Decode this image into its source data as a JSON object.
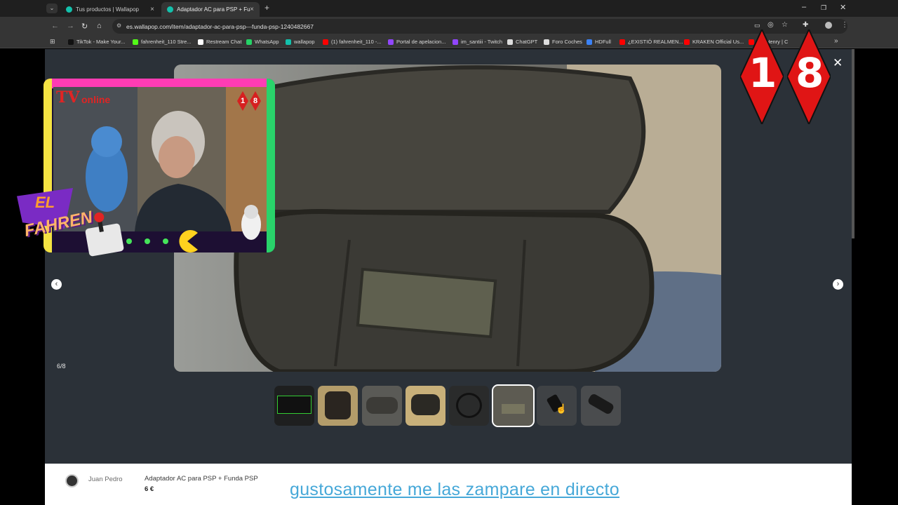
{
  "browser": {
    "tabs": [
      {
        "title": "Tus productos | Wallapop",
        "close": "×"
      },
      {
        "title": "Adaptador AC para PSP + Funda",
        "close": "×"
      }
    ],
    "new_tab": "+",
    "window_controls": {
      "minimize": "–",
      "restore": "❐",
      "close": "✕"
    },
    "url": "es.wallapop.com/item/adaptador-ac-para-psp---funda-psp-1240482667",
    "bookmarks": [
      {
        "label": "TikTok - Make Your...",
        "icon": "tiktok-icon",
        "color": "#111111"
      },
      {
        "label": "fahrenheit_110 Stre...",
        "icon": "kick-icon",
        "color": "#53fc18"
      },
      {
        "label": "Restream Chat",
        "icon": "restream-icon",
        "color": "#ffffff"
      },
      {
        "label": "WhatsApp",
        "icon": "whatsapp-icon",
        "color": "#25d366"
      },
      {
        "label": "wallapop",
        "icon": "wallapop-icon",
        "color": "#13c1ac"
      },
      {
        "label": "(1) fahrenheit_110 -...",
        "icon": "youtube-icon",
        "color": "#ff0000"
      },
      {
        "label": "Portal de apelacion...",
        "icon": "twitch-icon",
        "color": "#9146ff"
      },
      {
        "label": "im_santiii - Twitch",
        "icon": "twitch-icon",
        "color": "#9146ff"
      },
      {
        "label": "ChatGPT",
        "icon": "chatgpt-icon",
        "color": "#dddddd"
      },
      {
        "label": "Foro Coches",
        "icon": "forocoches-icon",
        "color": "#dddddd"
      },
      {
        "label": "HDFull",
        "icon": "hdfull-icon",
        "color": "#3b82f6"
      },
      {
        "label": "¿EXISTIÓ REALMEN...",
        "icon": "youtube-icon",
        "color": "#ff0000"
      },
      {
        "label": "KRAKEN Official Us...",
        "icon": "youtube-icon",
        "color": "#ff0000"
      },
      {
        "label": "ore Henry | C",
        "icon": "youtube-icon",
        "color": "#ff0000"
      }
    ]
  },
  "viewer": {
    "counter": "6/8",
    "prev": "‹",
    "next": "›",
    "close": "✕",
    "thumbnail_count": 8,
    "selected_thumbnail": 6
  },
  "listing": {
    "seller": "Juan Pedro",
    "title": "Adaptador AC para PSP + Funda PSP",
    "price": "6 €"
  },
  "overlay": {
    "cam_title_tv": "TV",
    "cam_title_online": "online",
    "cam_badge": [
      "1",
      "8"
    ],
    "logo_line1": "EL",
    "logo_line2": "FAHREN",
    "age_rating": [
      "1",
      "8"
    ],
    "subtitle": "gustosamente me las zampare en directo"
  }
}
